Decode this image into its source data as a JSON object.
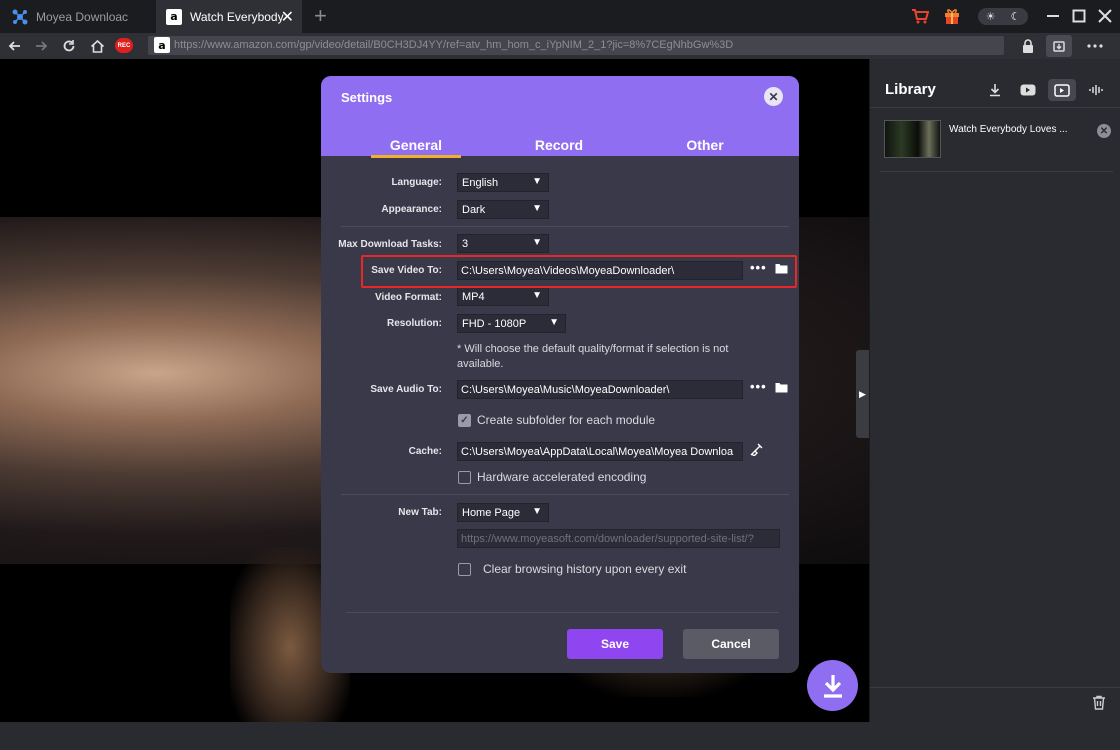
{
  "tabs": [
    {
      "label": "Moyea Downloac",
      "icon": "moyea-logo-icon"
    },
    {
      "label": "Watch Everybody",
      "icon": "amazon-icon"
    }
  ],
  "address": {
    "rec_label": "REC",
    "url": "https://www.amazon.com/gp/video/detail/B0CH3DJ4YY/ref=atv_hm_hom_c_iYpNIM_2_1?jic=8%7CEgNhbGw%3D"
  },
  "library": {
    "title": "Library",
    "items": [
      {
        "title": "Watch Everybody Loves ..."
      }
    ]
  },
  "dialog": {
    "title": "Settings",
    "tabs": [
      "General",
      "Record",
      "Other"
    ],
    "active_tab": "General",
    "language": {
      "label": "Language:",
      "value": "English"
    },
    "appearance": {
      "label": "Appearance:",
      "value": "Dark"
    },
    "max_tasks": {
      "label": "Max Download Tasks:",
      "value": "3"
    },
    "save_video": {
      "label": "Save Video To:",
      "value": "C:\\Users\\Moyea\\Videos\\MoyeaDownloader\\"
    },
    "video_format": {
      "label": "Video Format:",
      "value": "MP4"
    },
    "resolution": {
      "label": "Resolution:",
      "value": "FHD - 1080P"
    },
    "note": "* Will choose the default quality/format if selection is not available.",
    "save_audio": {
      "label": "Save Audio To:",
      "value": "C:\\Users\\Moyea\\Music\\MoyeaDownloader\\"
    },
    "subfolder": {
      "label": "Create subfolder for each module",
      "checked": true
    },
    "cache": {
      "label": "Cache:",
      "value": "C:\\Users\\Moyea\\AppData\\Local\\Moyea\\Moyea Downloa"
    },
    "hw_accel": {
      "label": "Hardware accelerated encoding",
      "checked": false
    },
    "new_tab": {
      "label": "New Tab:",
      "value": "Home Page",
      "url": "https://www.moyeasoft.com/downloader/supported-site-list/?"
    },
    "clear_history": {
      "label": "Clear browsing history upon every exit",
      "checked": false
    },
    "save_button": "Save",
    "cancel_button": "Cancel"
  },
  "colors": {
    "accent": "#8f6ef1",
    "save_button": "#8f46f0",
    "highlight": "#e82727",
    "tab_underline": "#f2b02a"
  }
}
